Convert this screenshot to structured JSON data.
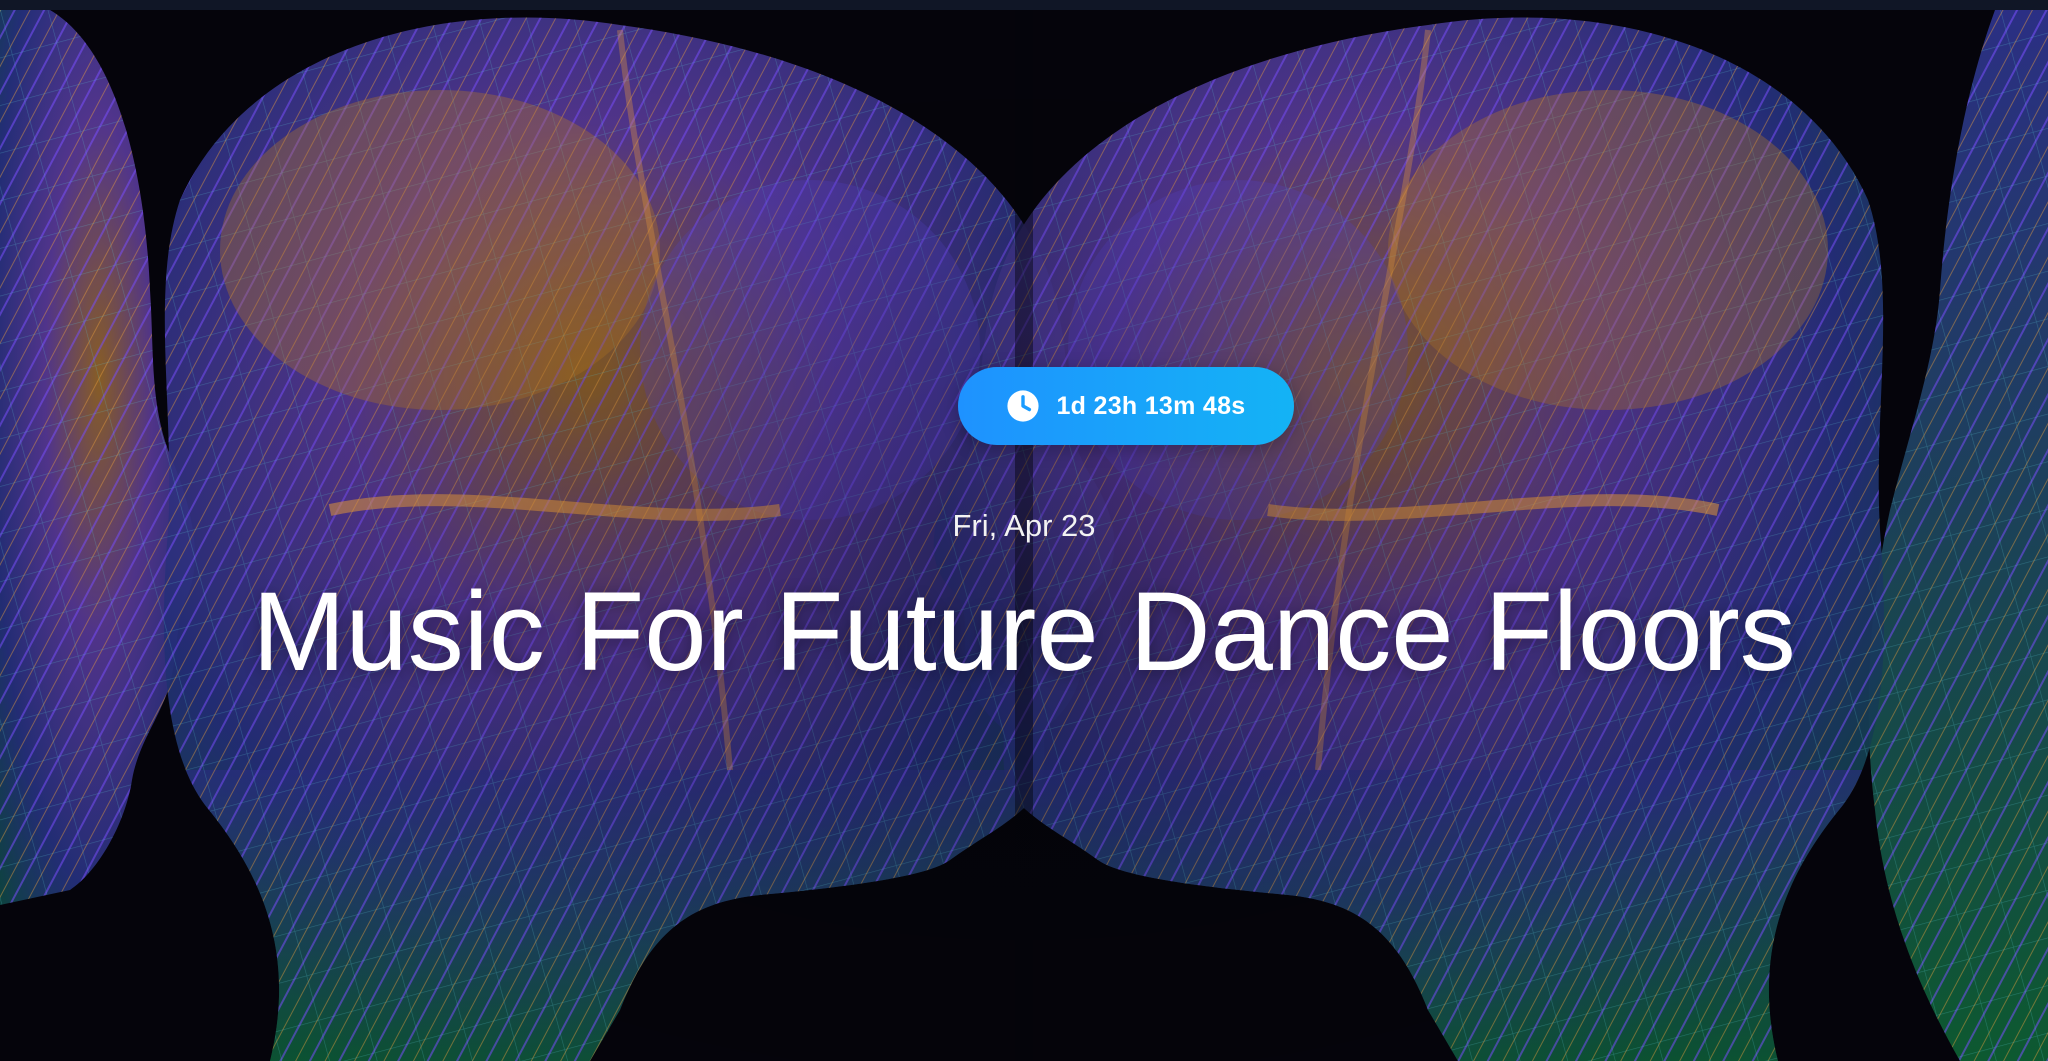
{
  "event": {
    "countdown": "1d 23h 13m 48s",
    "date": "Fri, Apr 23",
    "title": "Music For Future Dance Floors"
  },
  "icons": {
    "countdown": "clock-icon"
  },
  "colors": {
    "background": "#05040b",
    "pill_start": "#1e92ff",
    "pill_end": "#14b3f5",
    "text": "#ffffff"
  }
}
